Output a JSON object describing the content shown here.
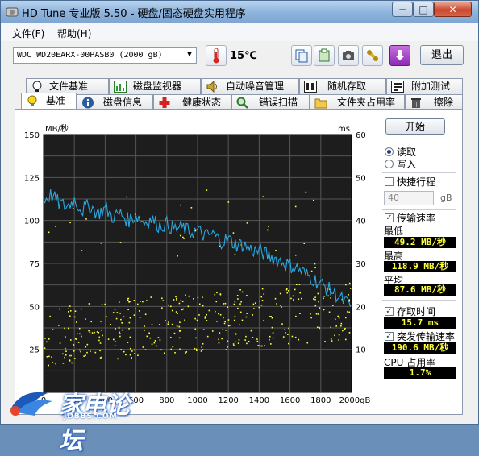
{
  "window": {
    "title": "HD Tune 专业版 5.50 - 硬盘/固态硬盘实用程序",
    "min": "─",
    "max": "□",
    "close": "✕"
  },
  "menu": [
    "文件(F)",
    "帮助(H)"
  ],
  "toolbar": {
    "drive": "WDC    WD20EARX-00PASB0  (2000 gB)",
    "temperature": "15℃",
    "exit_label": "退出"
  },
  "tabs_top": [
    {
      "label": "文件基准",
      "icon": "file-benchmark-icon"
    },
    {
      "label": "磁盘监视器",
      "icon": "disk-monitor-icon"
    },
    {
      "label": "自动噪音管理",
      "icon": "speaker-icon"
    },
    {
      "label": "随机存取",
      "icon": "random-access-icon"
    },
    {
      "label": "附加测试",
      "icon": "extra-tests-icon"
    }
  ],
  "tabs_bottom": [
    {
      "label": "基准",
      "icon": "lightbulb-icon",
      "active": true
    },
    {
      "label": "磁盘信息",
      "icon": "info-icon"
    },
    {
      "label": "健康状态",
      "icon": "health-cross-icon"
    },
    {
      "label": "错误扫描",
      "icon": "magnifier-icon"
    },
    {
      "label": "文件夹占用率",
      "icon": "folder-icon"
    },
    {
      "label": "擦除",
      "icon": "trash-icon"
    }
  ],
  "side": {
    "start_label": "开始",
    "read_label": "读取",
    "write_label": "写入",
    "short_stroke_label": "快捷行程",
    "short_stroke_value": "40",
    "short_stroke_unit": "gB",
    "transfer_rate_label": "传输速率",
    "min_label": "最低",
    "min_value": "49.2 MB/秒",
    "max_label": "最高",
    "max_value": "118.9 MB/秒",
    "avg_label": "平均",
    "avg_value": "87.6 MB/秒",
    "access_time_label": "存取时间",
    "access_time_value": "15.7 ms",
    "burst_label": "突发传输速率",
    "burst_value": "190.6 MB/秒",
    "cpu_label": "CPU 占用率",
    "cpu_value": "1.7%"
  },
  "watermark": {
    "text": "家电论坛",
    "sub": "JDBBS.COM"
  },
  "colors": {
    "transfer_line": "#29a8e0",
    "access_dots": "#ffff3a",
    "plot_bg": "#1d1d1d",
    "grid": "#555555"
  },
  "chart_data": {
    "type": "line",
    "ylabel_left": "MB/秒",
    "ylabel_right": "ms",
    "y_left_ticks": [
      25,
      50,
      75,
      100,
      125,
      150
    ],
    "y_right_ticks": [
      10,
      20,
      30,
      40,
      50,
      60
    ],
    "x_ticks": [
      "0",
      "200",
      "400",
      "600",
      "800",
      "1000",
      "1200",
      "1400",
      "1600",
      "1800",
      "2000gB"
    ],
    "ylim_left": [
      0,
      150
    ],
    "ylim_right": [
      0,
      60
    ],
    "xlim": [
      0,
      2000
    ],
    "grid": true,
    "series": [
      {
        "name": "传输速率",
        "axis": "left",
        "x": [
          0,
          50,
          100,
          150,
          200,
          250,
          300,
          350,
          400,
          450,
          500,
          550,
          600,
          650,
          700,
          750,
          800,
          850,
          900,
          950,
          1000,
          1050,
          1100,
          1150,
          1200,
          1250,
          1300,
          1350,
          1400,
          1450,
          1500,
          1550,
          1600,
          1650,
          1700,
          1750,
          1800,
          1850,
          1900,
          1950,
          2000
        ],
        "values": [
          112,
          115,
          110,
          108,
          112,
          106,
          109,
          104,
          107,
          102,
          104,
          100,
          103,
          99,
          101,
          97,
          98,
          95,
          96,
          93,
          94,
          91,
          92,
          88,
          89,
          86,
          86,
          83,
          82,
          80,
          78,
          76,
          74,
          72,
          69,
          66,
          63,
          60,
          57,
          53,
          50
        ]
      }
    ],
    "scatter": {
      "name": "存取时间",
      "axis": "right",
      "trend_x": [
        0,
        500,
        1000,
        1500,
        2000
      ],
      "trend_y": [
        13,
        15,
        16.5,
        18,
        19.5
      ]
    }
  }
}
